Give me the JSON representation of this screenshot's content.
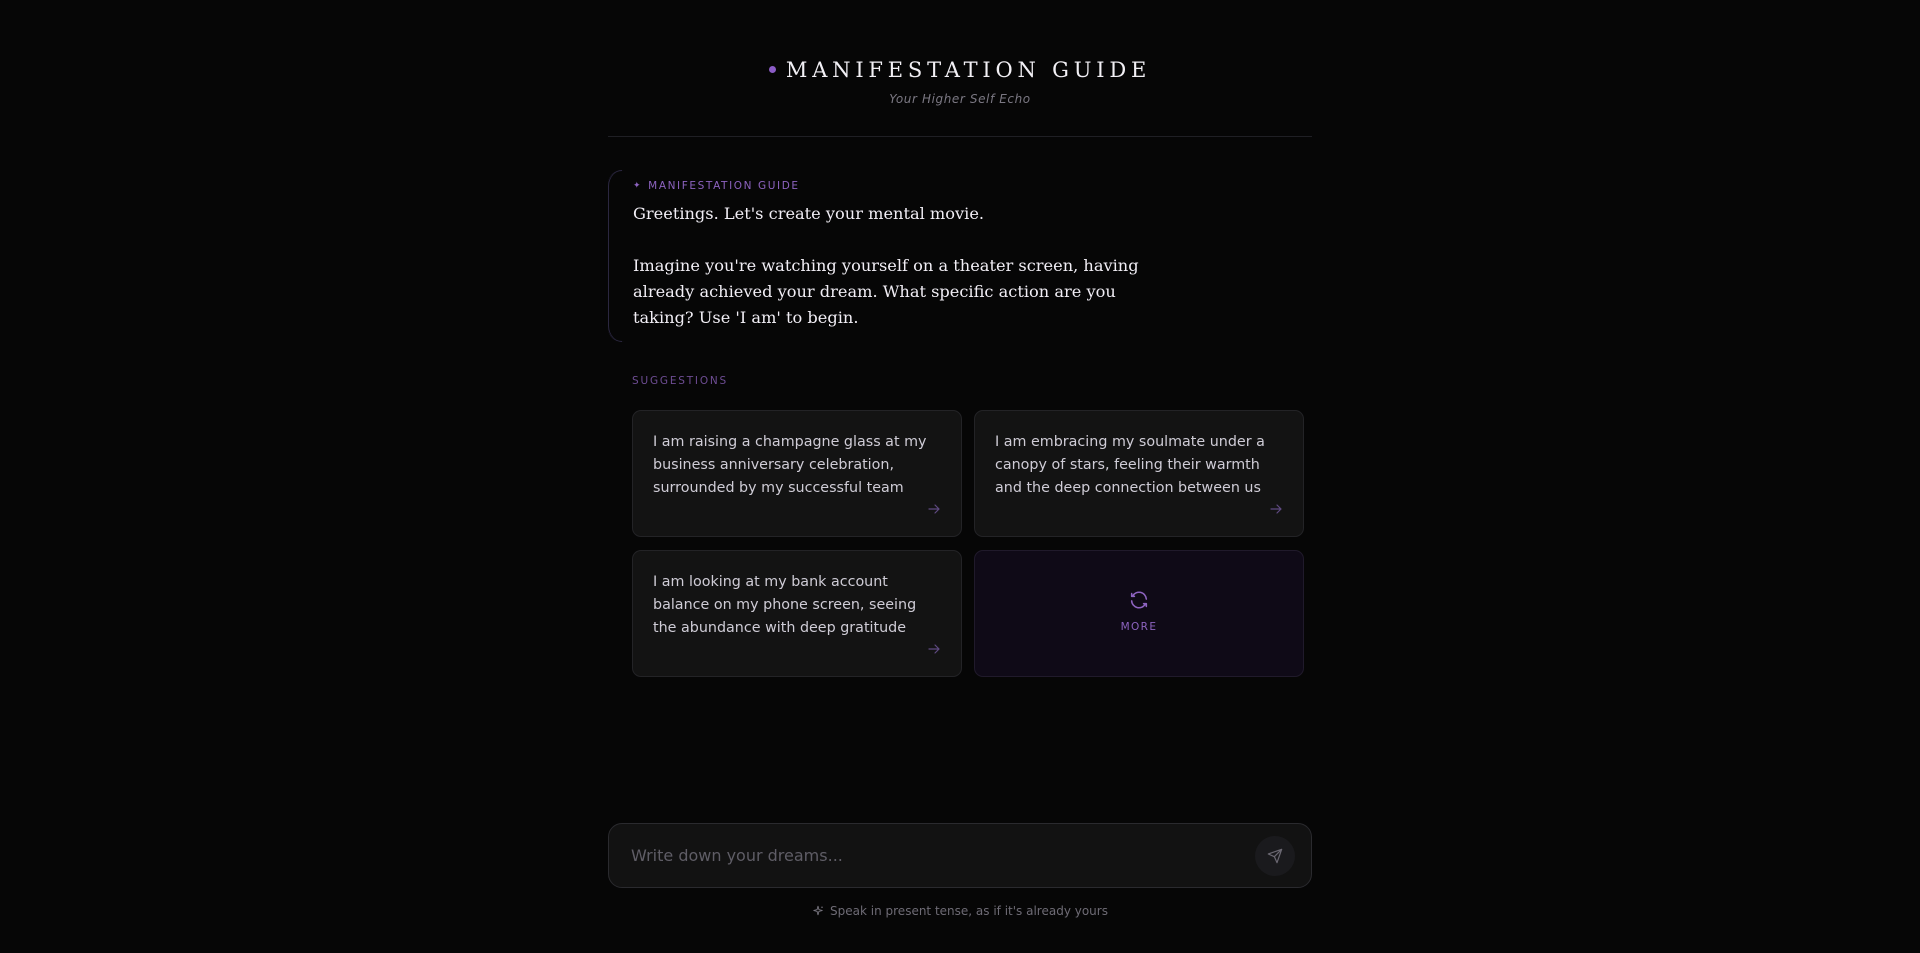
{
  "header": {
    "title": "MANIFESTATION GUIDE",
    "subtitle": "Your Higher Self Echo"
  },
  "message": {
    "sender_label": "MANIFESTATION GUIDE",
    "paragraph_1": "Greetings. Let's create your mental movie.",
    "paragraph_2": "Imagine you're watching yourself on a theater screen, having already achieved your dream. What specific action are you taking? Use 'I am' to begin."
  },
  "suggestions": {
    "label": "SUGGESTIONS",
    "items": [
      {
        "text": "I am raising a champagne glass at my business anniversary celebration, surrounded by my successful team"
      },
      {
        "text": "I am embracing my soulmate under a canopy of stars, feeling their warmth and the deep connection between us"
      },
      {
        "text": "I am looking at my bank account balance on my phone screen, seeing the abundance with deep gratitude"
      }
    ],
    "more_label": "MORE"
  },
  "composer": {
    "placeholder": "Write down your dreams...",
    "value": "",
    "hint": "Speak in present tense, as if it's already yours"
  },
  "colors": {
    "background": "#060606",
    "accent": "#8d63c0",
    "card": "#131313",
    "more_card": "#0f0a17"
  },
  "icons": {
    "title": "dot-icon",
    "label": "sparkle-icon",
    "card_action": "arrow-right-icon",
    "more": "refresh-icon",
    "send": "send-icon",
    "hint": "sparkles-icon"
  }
}
